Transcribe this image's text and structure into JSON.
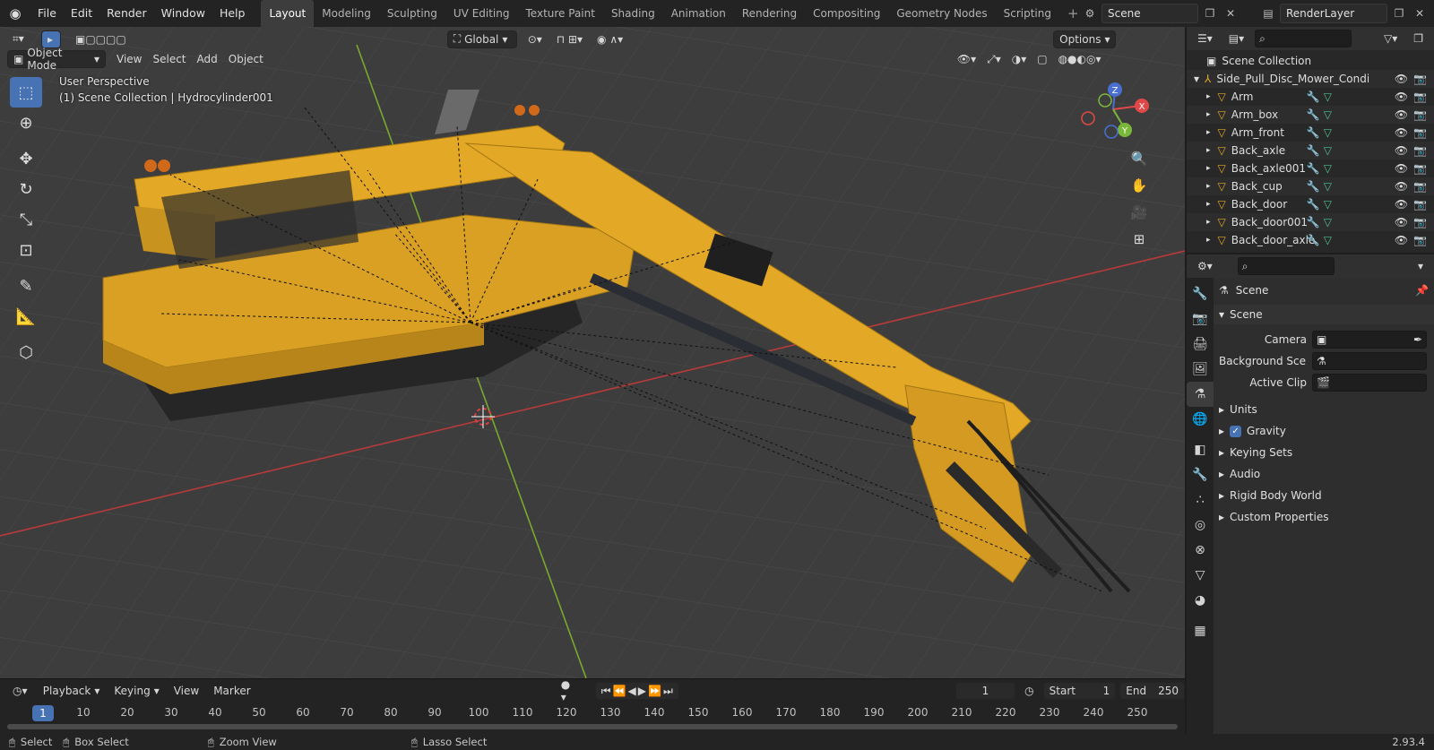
{
  "topbar": {
    "menus": [
      "File",
      "Edit",
      "Render",
      "Window",
      "Help"
    ],
    "workspaces": [
      "Layout",
      "Modeling",
      "Sculpting",
      "UV Editing",
      "Texture Paint",
      "Shading",
      "Animation",
      "Rendering",
      "Compositing",
      "Geometry Nodes",
      "Scripting"
    ],
    "active_workspace": "Layout",
    "scene_name": "Scene",
    "view_layer": "RenderLayer"
  },
  "viewport": {
    "transform_orientation": "Global",
    "options_label": "Options",
    "mode": "Object Mode",
    "menus": [
      "View",
      "Select",
      "Add",
      "Object"
    ],
    "view_name": "User Perspective",
    "collection_info": "(1) Scene Collection | Hydrocylinder001",
    "gizmo_axes": {
      "z": "Z",
      "y": "Y",
      "x": "X"
    }
  },
  "timeline": {
    "menus": [
      "Playback",
      "Keying",
      "View",
      "Marker"
    ],
    "current_frame": "1",
    "start_label": "Start",
    "start": "1",
    "end_label": "End",
    "end": "250",
    "ticks": [
      "1",
      "10",
      "20",
      "30",
      "40",
      "50",
      "60",
      "70",
      "80",
      "90",
      "100",
      "110",
      "120",
      "130",
      "140",
      "150",
      "160",
      "170",
      "180",
      "190",
      "200",
      "210",
      "220",
      "230",
      "240",
      "250"
    ]
  },
  "status": {
    "select": "Select",
    "box_select": "Box Select",
    "zoom_view": "Zoom View",
    "lasso_select": "Lasso Select",
    "version": "2.93.4"
  },
  "outliner": {
    "root": "Scene Collection",
    "parent": "Side_Pull_Disc_Mower_Condi",
    "items": [
      "Arm",
      "Arm_box",
      "Arm_front",
      "Back_axle",
      "Back_axle001",
      "Back_cup",
      "Back_door",
      "Back_door001",
      "Back_door_axle"
    ]
  },
  "properties": {
    "context": "Scene",
    "panel_title": "Scene",
    "camera_label": "Camera",
    "background_label": "Background Sce...",
    "active_clip_label": "Active Clip",
    "sections": [
      "Units",
      "Gravity",
      "Keying Sets",
      "Audio",
      "Rigid Body World",
      "Custom Properties"
    ],
    "gravity_checked": true
  },
  "colors": {
    "accent": "#4772b3",
    "mower_yellow": "#e3a825",
    "x_axis": "#b83a3a",
    "y_axis": "#7aa82f"
  }
}
